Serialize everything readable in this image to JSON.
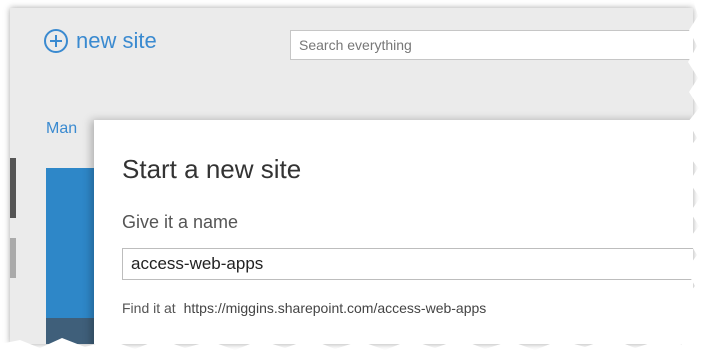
{
  "header": {
    "new_site_label": "new site",
    "search_placeholder": "Search everything"
  },
  "nav": {
    "manage_label": "Man"
  },
  "dialog": {
    "title": "Start a new site",
    "name_label": "Give it a name",
    "name_value": "access-web-apps",
    "find_prefix": "Find it at",
    "find_url": "https://miggins.sharepoint.com/access-web-apps"
  },
  "colors": {
    "accent": "#3a8ad0",
    "tile": "#2e87c8",
    "page_bg": "#ebebeb"
  },
  "icons": {
    "new_site": "plus-circle-icon"
  }
}
